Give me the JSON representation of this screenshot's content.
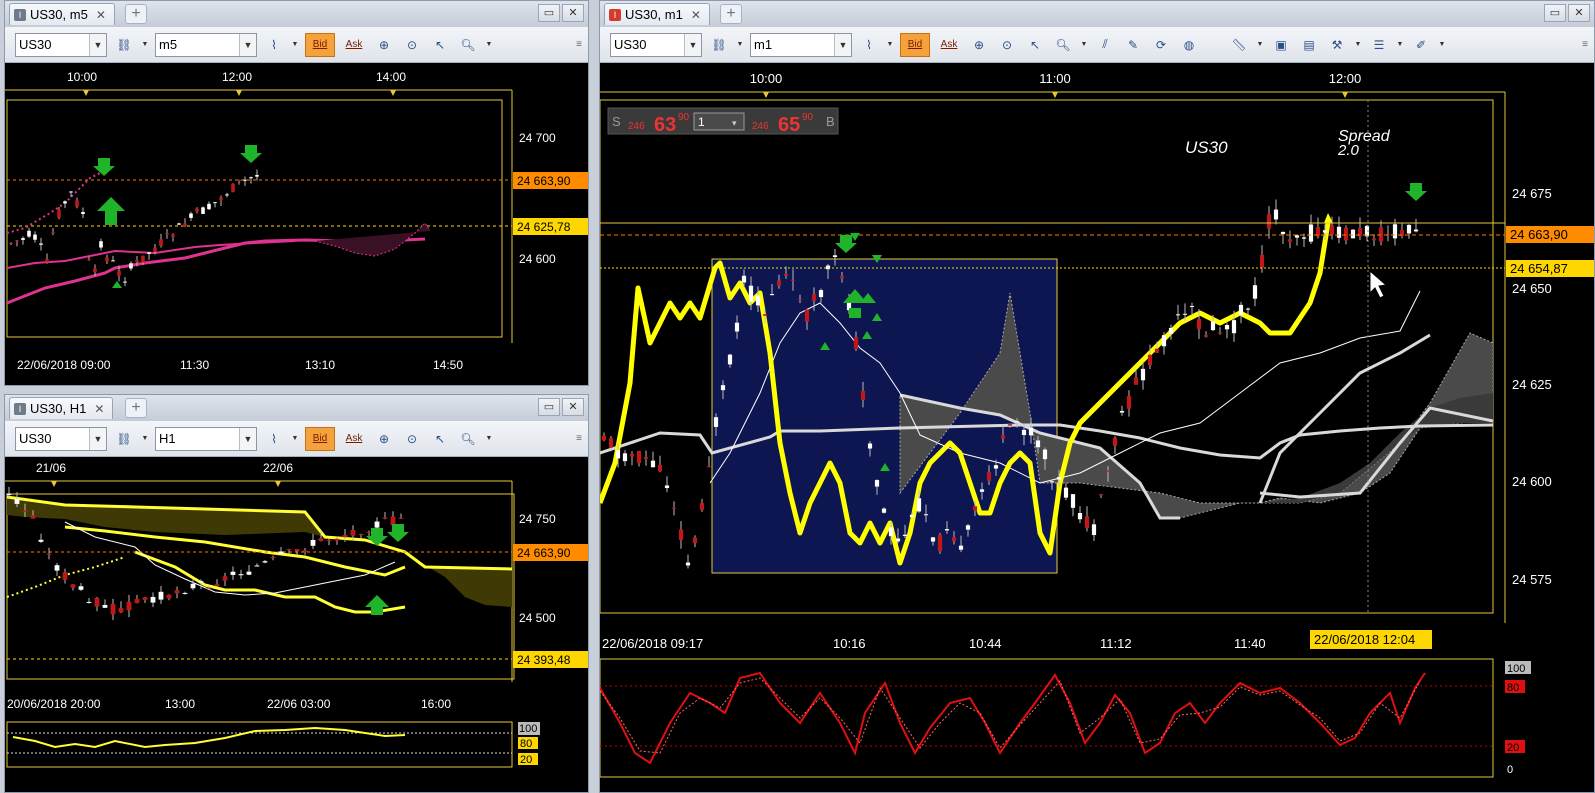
{
  "windows": {
    "m5": {
      "tab": "US30, m5",
      "symbol": "US30",
      "timeframe": "m5",
      "bid": "Bid",
      "ask": "Ask",
      "top_times": [
        "10:00",
        "12:00",
        "14:00"
      ],
      "prices": [
        "24 700",
        "24 663,90",
        "24 625,78",
        "24 600"
      ],
      "bottom_times": [
        "22/06/2018 09:00",
        "11:30",
        "13:10",
        "14:50"
      ]
    },
    "h1": {
      "tab": "US30, H1",
      "symbol": "US30",
      "timeframe": "H1",
      "bid": "Bid",
      "ask": "Ask",
      "top_times": [
        "21/06",
        "22/06"
      ],
      "prices": [
        "24 750",
        "24 663,90",
        "24 500",
        "24 393,48"
      ],
      "bottom_times": [
        "20/06/2018 20:00",
        "13:00",
        "22/06 03:00",
        "16:00"
      ],
      "osc_levels": [
        "100",
        "80",
        "20"
      ]
    },
    "m1": {
      "tab": "US30, m1",
      "symbol": "US30",
      "timeframe": "m1",
      "bid": "Bid",
      "ask": "Ask",
      "top_times": [
        "10:00",
        "11:00",
        "12:00"
      ],
      "prices": [
        "24 675",
        "24 663,90",
        "24 654,87",
        "24 650",
        "24 625",
        "24 600",
        "24 575"
      ],
      "bottom_times": [
        "22/06/2018 09:17",
        "10:16",
        "10:44",
        "11:12",
        "11:40"
      ],
      "cursor_time": "22/06/2018 12:04",
      "trade": {
        "sell_label": "S",
        "sell_small": "246",
        "sell_big": "63",
        "sell_sup": "90",
        "lot": "1",
        "buy_small": "246",
        "buy_big": "65",
        "buy_sup": "90",
        "buy_label": "B"
      },
      "watermark_symbol": "US30",
      "spread_label": "Spread",
      "spread_value": "2.0",
      "osc_levels": [
        "100",
        "80",
        "20",
        "0"
      ]
    }
  },
  "colors": {
    "price_orange": "#ff8c00",
    "price_yellow": "#ffd700",
    "bid_button": "#f5a23c",
    "candle_up": "#ffffff",
    "candle_down": "#c01818",
    "tenkan": "#ffff00",
    "kijun": "#d9d9d9",
    "cloud": "#555555",
    "selection_box": "#0d1650",
    "stochastic": "#e01010"
  },
  "icons": [
    "indicator-icon",
    "crosshair-icon",
    "zoom-icon",
    "ruler-icon",
    "globe-icon",
    "arrow-down-signal-icon",
    "arrow-up-signal-icon"
  ]
}
